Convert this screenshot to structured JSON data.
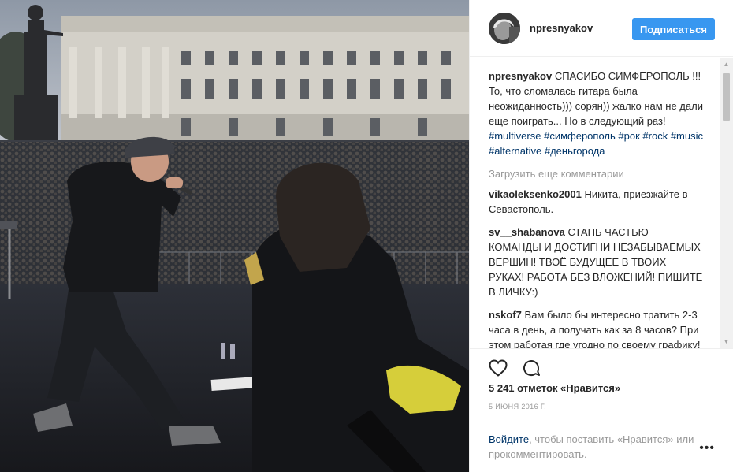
{
  "header": {
    "username": "npresnyakov",
    "follow_label": "Подписаться"
  },
  "caption": {
    "username": "npresnyakov",
    "text": "СПАСИБО СИМФЕРОПОЛЬ !!! То, что сломалась гитара была неожиданность))) сорян)) жалко нам не дали еще поиграть... Но в следующий раз!",
    "hashtags": [
      "#multiverse",
      "#симферополь",
      "#рок",
      "#rock",
      "#music",
      "#alternative",
      "#деньгорода"
    ]
  },
  "load_more_label": "Загрузить еще комментарии",
  "comments": [
    {
      "username": "vikaoleksenko2001",
      "text": "Никита, приезжайте в Севастополь."
    },
    {
      "username": "sv__shabanova",
      "text": "СТАНЬ ЧАСТЬЮ КОМАНДЫ И ДОСТИГНИ НЕЗАБЫВАЕМЫХ ВЕРШИН! ТВОЁ БУДУЩЕЕ В ТВОИХ РУКАХ! РАБОТА БЕЗ ВЛОЖЕНИЙ! ПИШИТЕ В ЛИЧКУ:)"
    },
    {
      "username": "nskof7",
      "text": "Вам было бы интересно тратить 2-3 часа в день, а получать как за 8 часов? При этом работая где угодно по своему графику! Обращайтесь, я Вас"
    }
  ],
  "actions": {
    "like_icon": "heart-icon",
    "comment_icon": "comment-icon",
    "likes_text": "5 241 отметок «Нравится»",
    "date_text": "5 июня 2016 г."
  },
  "footer": {
    "login_link": "Войдите",
    "login_rest": ", чтобы поставить «Нравится» или прокомментировать.",
    "more_label": "•••"
  },
  "colors": {
    "accent": "#3897f0",
    "link": "#003569",
    "muted": "#999999"
  }
}
